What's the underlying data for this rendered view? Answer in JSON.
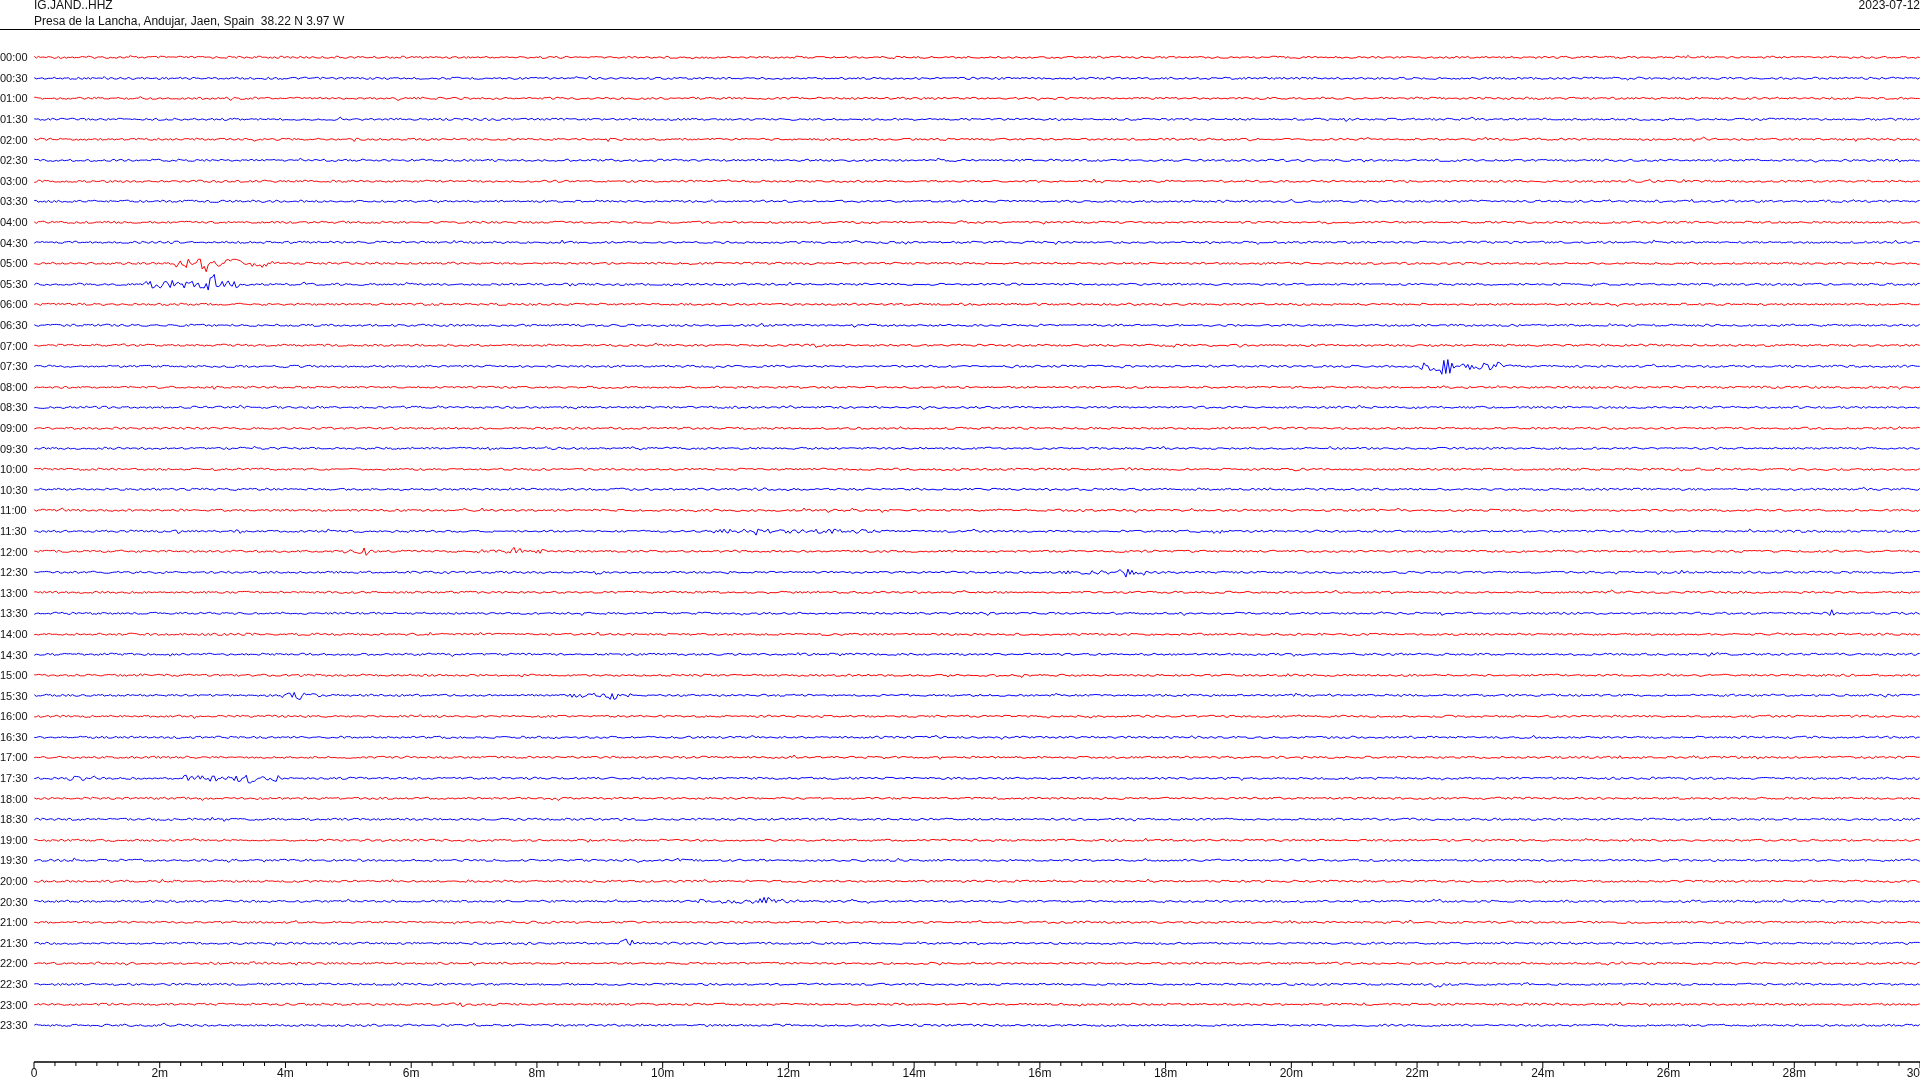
{
  "header": {
    "station": "IG.JAND..HHZ",
    "location": "Presa de la Lancha, Andujar, Jaen, Spain  38.22 N 3.97 W",
    "date": "2023-07-12"
  },
  "rows": [
    {
      "time": "00:00",
      "color": "#ff0000"
    },
    {
      "time": "00:30",
      "color": "#0000ff"
    },
    {
      "time": "01:00",
      "color": "#ff0000"
    },
    {
      "time": "01:30",
      "color": "#0000ff"
    },
    {
      "time": "02:00",
      "color": "#ff0000"
    },
    {
      "time": "02:30",
      "color": "#0000ff"
    },
    {
      "time": "03:00",
      "color": "#ff0000"
    },
    {
      "time": "03:30",
      "color": "#0000ff"
    },
    {
      "time": "04:00",
      "color": "#ff0000"
    },
    {
      "time": "04:30",
      "color": "#0000ff"
    },
    {
      "time": "05:00",
      "color": "#ff0000"
    },
    {
      "time": "05:30",
      "color": "#0000ff"
    },
    {
      "time": "06:00",
      "color": "#ff0000"
    },
    {
      "time": "06:30",
      "color": "#0000ff"
    },
    {
      "time": "07:00",
      "color": "#ff0000"
    },
    {
      "time": "07:30",
      "color": "#0000ff"
    },
    {
      "time": "08:00",
      "color": "#ff0000"
    },
    {
      "time": "08:30",
      "color": "#0000ff"
    },
    {
      "time": "09:00",
      "color": "#ff0000"
    },
    {
      "time": "09:30",
      "color": "#0000ff"
    },
    {
      "time": "10:00",
      "color": "#ff0000"
    },
    {
      "time": "10:30",
      "color": "#0000ff"
    },
    {
      "time": "11:00",
      "color": "#ff0000"
    },
    {
      "time": "11:30",
      "color": "#0000ff"
    },
    {
      "time": "12:00",
      "color": "#ff0000"
    },
    {
      "time": "12:30",
      "color": "#0000ff"
    },
    {
      "time": "13:00",
      "color": "#ff0000"
    },
    {
      "time": "13:30",
      "color": "#0000ff"
    },
    {
      "time": "14:00",
      "color": "#ff0000"
    },
    {
      "time": "14:30",
      "color": "#0000ff"
    },
    {
      "time": "15:00",
      "color": "#ff0000"
    },
    {
      "time": "15:30",
      "color": "#0000ff"
    },
    {
      "time": "16:00",
      "color": "#ff0000"
    },
    {
      "time": "16:30",
      "color": "#0000ff"
    },
    {
      "time": "17:00",
      "color": "#ff0000"
    },
    {
      "time": "17:30",
      "color": "#0000ff"
    },
    {
      "time": "18:00",
      "color": "#ff0000"
    },
    {
      "time": "18:30",
      "color": "#0000ff"
    },
    {
      "time": "19:00",
      "color": "#ff0000"
    },
    {
      "time": "19:30",
      "color": "#0000ff"
    },
    {
      "time": "20:00",
      "color": "#ff0000"
    },
    {
      "time": "20:30",
      "color": "#0000ff"
    },
    {
      "time": "21:00",
      "color": "#ff0000"
    },
    {
      "time": "21:30",
      "color": "#0000ff"
    },
    {
      "time": "22:00",
      "color": "#ff0000"
    },
    {
      "time": "22:30",
      "color": "#0000ff"
    },
    {
      "time": "23:00",
      "color": "#ff0000"
    },
    {
      "time": "23:30",
      "color": "#0000ff"
    }
  ],
  "axis": {
    "labels": [
      "0",
      "2m",
      "4m",
      "6m",
      "8m",
      "10m",
      "12m",
      "14m",
      "16m",
      "18m",
      "20m",
      "22m",
      "24m",
      "26m",
      "28m",
      "30"
    ]
  }
}
